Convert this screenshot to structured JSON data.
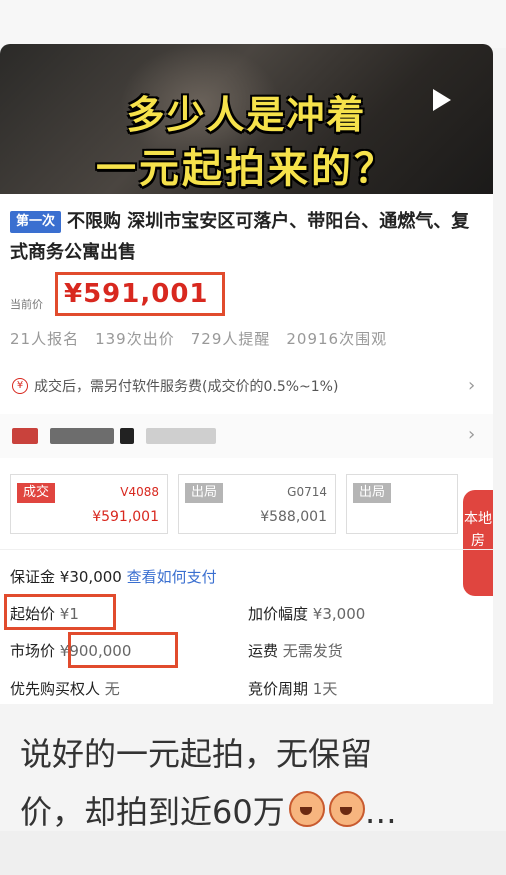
{
  "video": {
    "caption_line1": "多少人是冲着",
    "caption_line2": "一元起拍来的？",
    "play_icon": "play-icon"
  },
  "listing": {
    "badge": "第一次",
    "title": "不限购 深圳市宝安区可落户、带阳台、通燃气、复式商务公寓出售",
    "price_label": "当前价",
    "price": "¥591,001",
    "stats": [
      "21人报名",
      "139次出价",
      "729人提醒",
      "20916次围观"
    ]
  },
  "fee_notice": {
    "text": "成交后，需另付软件服务费(成交价的0.5%~1%)",
    "icon": "yen-circle-icon"
  },
  "records": [
    {
      "tag": "成交",
      "code": "V4088",
      "price": "¥591,001",
      "tag_color": "#e0453f"
    },
    {
      "tag": "出局",
      "code": "G0714",
      "price": "¥588,001",
      "tag_color": "#b5b5b5"
    },
    {
      "tag": "出局",
      "code": "",
      "price": "",
      "tag_color": "#b5b5b5"
    }
  ],
  "local_tab": "本地房",
  "details": {
    "deposit_label": "保证金",
    "deposit_value": "¥30,000",
    "deposit_link": "查看如何支付",
    "start_label": "起始价",
    "start_value": "¥1",
    "increment_label": "加价幅度",
    "increment_value": "¥3,000",
    "market_label": "市场价",
    "market_value": "¥900,000",
    "shipping_label": "运费",
    "shipping_value": "无需发货",
    "priority_label": "优先购买权人",
    "priority_value": "无",
    "cycle_label": "竞价周期",
    "cycle_value": "1天"
  },
  "comment": {
    "line1": "说好的一元起拍，无保留",
    "line2": "价，却拍到近60万",
    "suffix": "…"
  }
}
